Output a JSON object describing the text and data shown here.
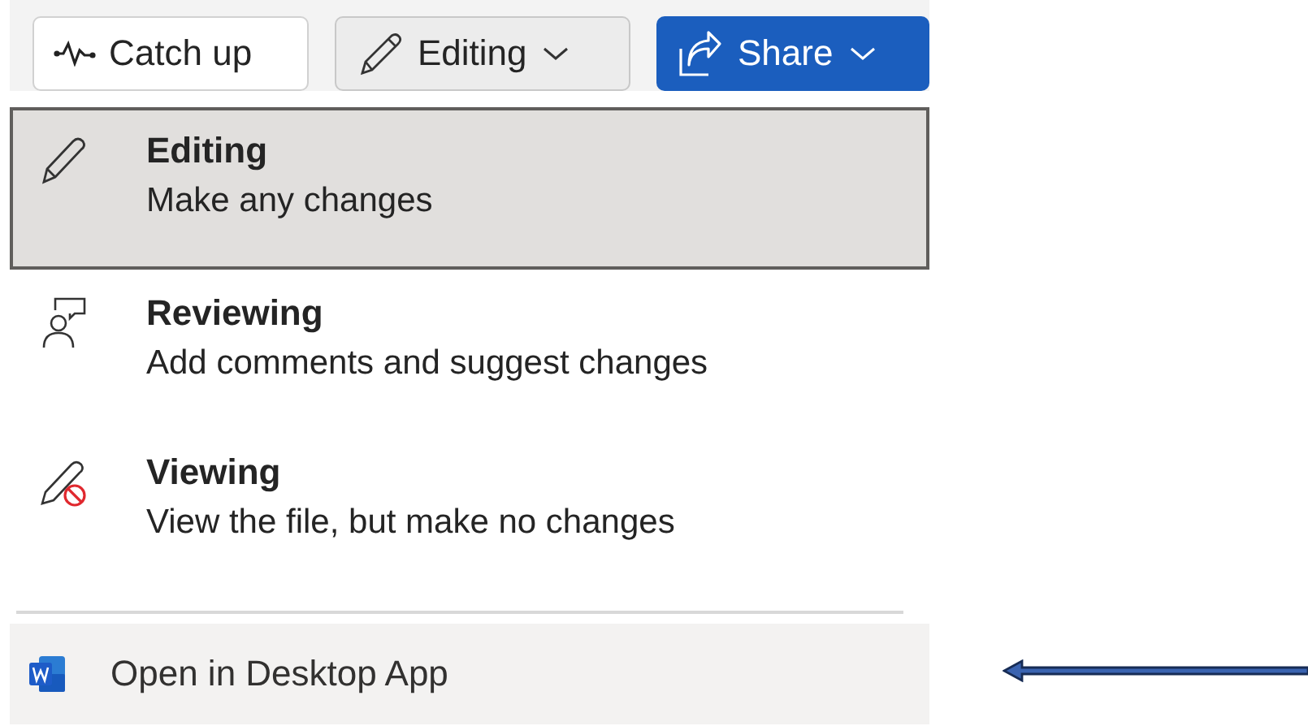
{
  "toolbar": {
    "catch_up": {
      "label": "Catch up"
    },
    "mode": {
      "label": "Editing"
    },
    "share": {
      "label": "Share"
    }
  },
  "menu": {
    "items": [
      {
        "kind": "pencil",
        "title": "Editing",
        "description": "Make any changes",
        "selected": true
      },
      {
        "kind": "review",
        "title": "Reviewing",
        "description": "Add comments and suggest changes",
        "selected": false
      },
      {
        "kind": "view",
        "title": "Viewing",
        "description": "View the file, but make no changes",
        "selected": false
      }
    ],
    "open_app": {
      "label": "Open in Desktop App"
    }
  }
}
